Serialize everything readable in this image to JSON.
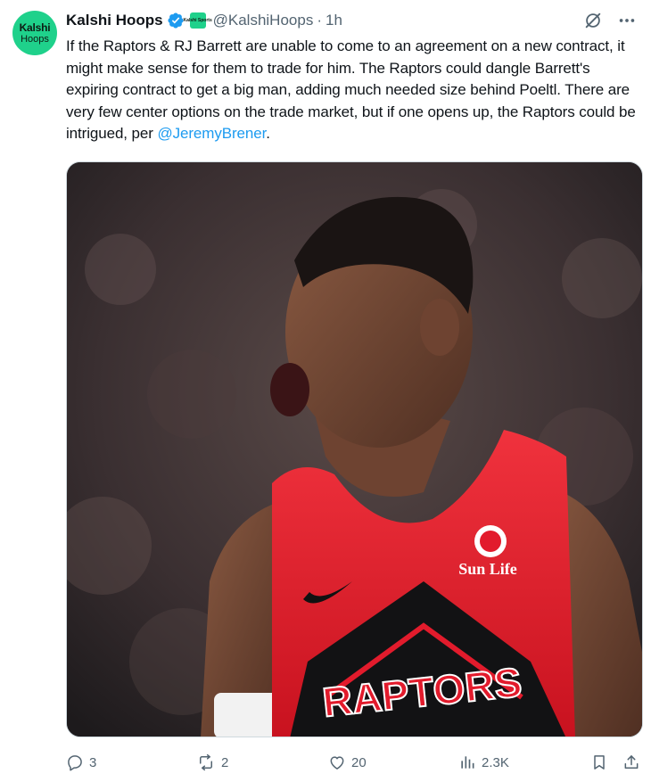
{
  "account": {
    "avatar_line1": "Kalshi",
    "avatar_line2": "Hoops",
    "name": "Kalshi Hoops",
    "affiliate_badge": "Kalshi Sports",
    "handle": "@KalshiHoops",
    "separator": "·",
    "time": "1h"
  },
  "post": {
    "text": "If the Raptors & RJ Barrett are unable to come to an agreement on a new contract, it might make sense for them to trade for him. The Raptors could dangle Barrett's expiring contract to get a big man, adding much needed size behind Poeltl. There are very few center options on the trade market, but if one opens up, the Raptors could be intrigued, per ",
    "mention": "@JeremyBrener",
    "end": "."
  },
  "media": {
    "jersey_wordmark": "RAPTORS",
    "sponsor": "Sun Life"
  },
  "actions": {
    "replies": "3",
    "reposts": "2",
    "likes": "20",
    "views": "2.3K"
  },
  "colors": {
    "accent": "#1d9bf0",
    "kalshi_green": "#1fd18b",
    "muted": "#536471",
    "jersey_red": "#e21b2c"
  },
  "icons": [
    "verified-badge-icon",
    "grok-icon",
    "more-icon",
    "reply-icon",
    "repost-icon",
    "like-icon",
    "views-icon",
    "bookmark-icon",
    "share-icon"
  ]
}
